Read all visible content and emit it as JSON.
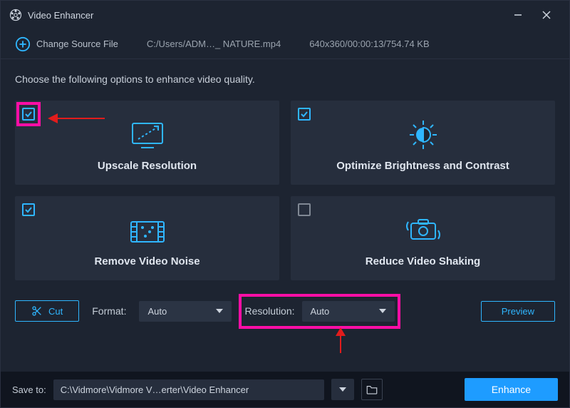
{
  "app": {
    "title": "Video Enhancer"
  },
  "toolbar": {
    "change_label": "Change Source File",
    "filepath": "C:/Users/ADM…_ NATURE.mp4",
    "fileinfo": "640x360/00:00:13/754.74 KB"
  },
  "prompt": "Choose the following options to enhance video quality.",
  "cards": [
    {
      "label": "Upscale Resolution",
      "checked": true
    },
    {
      "label": "Optimize Brightness and Contrast",
      "checked": true
    },
    {
      "label": "Remove Video Noise",
      "checked": true
    },
    {
      "label": "Reduce Video Shaking",
      "checked": false
    }
  ],
  "controls": {
    "cut_label": "Cut",
    "format_label": "Format:",
    "format_value": "Auto",
    "resolution_label": "Resolution:",
    "resolution_value": "Auto",
    "preview_label": "Preview"
  },
  "footer": {
    "save_label": "Save to:",
    "save_path": "C:\\Vidmore\\Vidmore V…erter\\Video Enhancer",
    "enhance_label": "Enhance"
  }
}
